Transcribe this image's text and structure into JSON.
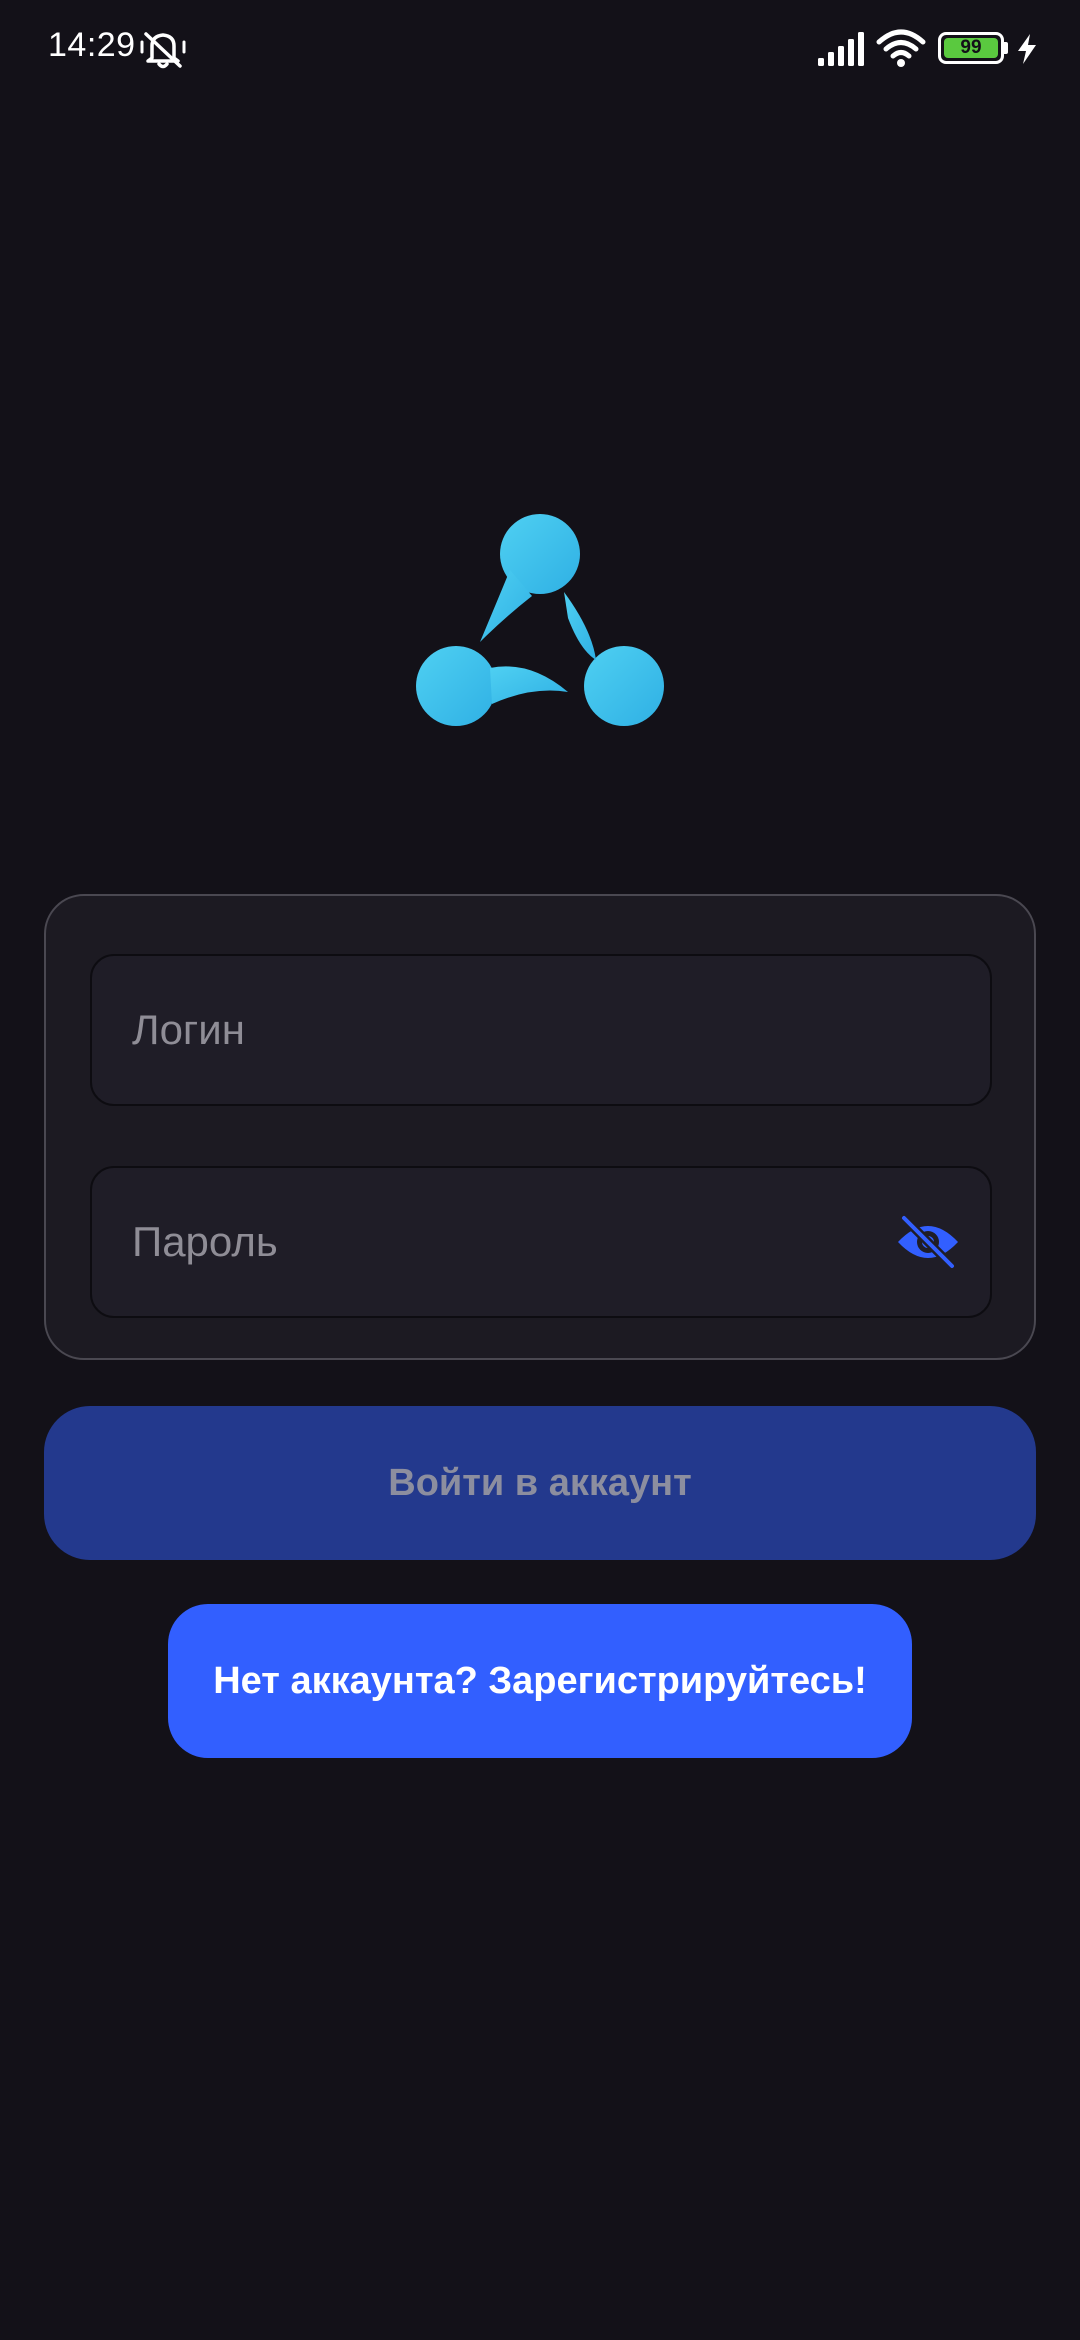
{
  "status_bar": {
    "time": "14:29",
    "battery_level": "99",
    "icons": [
      "notifications-muted-icon",
      "signal-icon",
      "wifi-icon",
      "battery-icon",
      "charging-icon"
    ]
  },
  "logo": {
    "icon": "three-node-logo-icon",
    "color_start": "#4fd0f2",
    "color_end": "#2fb0e4"
  },
  "form": {
    "login_placeholder": "Логин",
    "login_value": "",
    "password_placeholder": "Пароль",
    "password_value": "",
    "password_toggle_icon": "eye-off-icon"
  },
  "buttons": {
    "login_label": "Войти в аккаунт",
    "register_label": "Нет аккаунта? Зарегистрируйтесь!"
  },
  "colors": {
    "background": "#131118",
    "card": "#1c1a22",
    "primary": "#325fff",
    "primary_disabled": "#23398d"
  }
}
